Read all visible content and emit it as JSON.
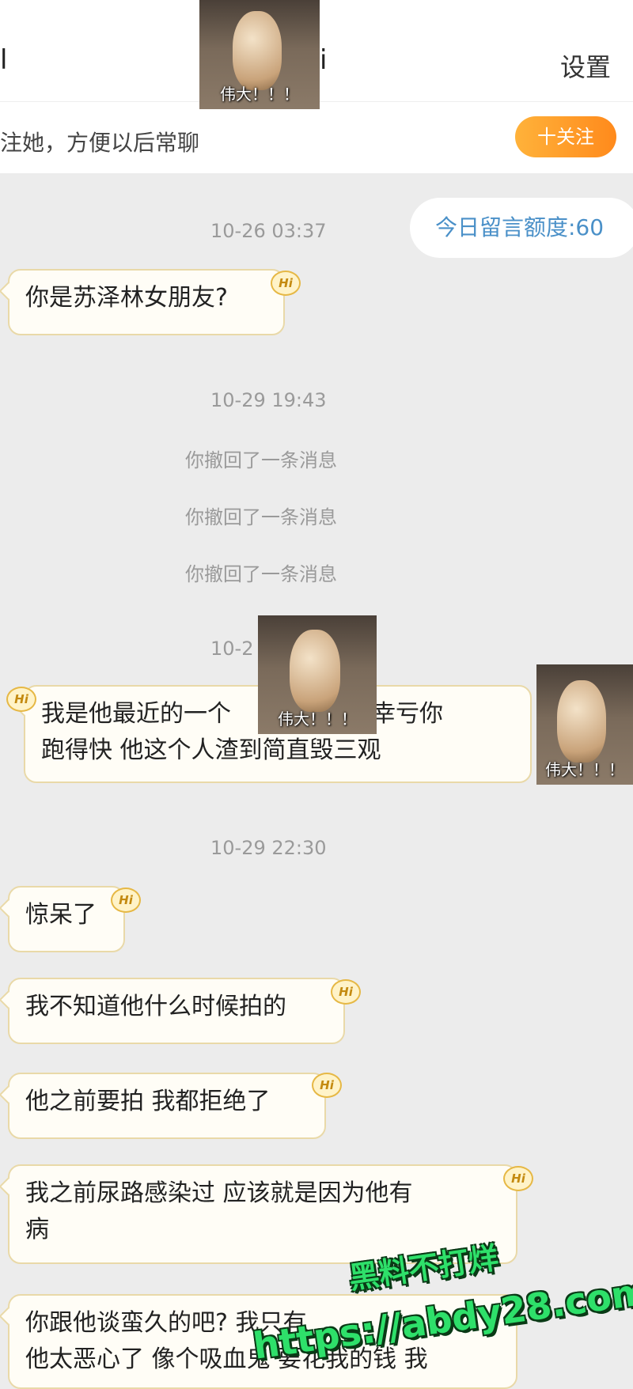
{
  "header": {
    "title_left": "l",
    "title_right": "i",
    "settings_label": "设置"
  },
  "follow_bar": {
    "prompt": "注她，方便以后常聊",
    "follow_button": "十关注"
  },
  "quota": "今日留言额度:60",
  "sticker_caption": "伟大！！！",
  "hi_badge": "Hi",
  "messages": {
    "ts1": "10-26 03:37",
    "m1": "你是苏泽林女朋友?",
    "ts2": "10-29 19:43",
    "recall1": "你撤回了一条消息",
    "recall2": "你撤回了一条消息",
    "recall3": "你撤回了一条消息",
    "ts3": "10-2",
    "m2_line1": "我是他最近的一个",
    "m2_line1_end": "妹幸亏你",
    "m2_line2": "跑得快  他这个人渣到简直毁三观",
    "ts4": "10-29 22:30",
    "m3": "惊呆了",
    "m4": "我不知道他什么时候拍的",
    "m5": "他之前要拍 我都拒绝了",
    "m6_line1": "我之前尿路感染过 应该就是因为他有",
    "m6_line2": "病",
    "m7_line1": "你跟他谈蛮久的吧? 我只有",
    "m7_line2": "他太恶心了 像个吸血鬼 要花我的钱 我"
  },
  "watermark": {
    "line1": "黑料不打烊",
    "line2": "https://abdy28.com"
  }
}
